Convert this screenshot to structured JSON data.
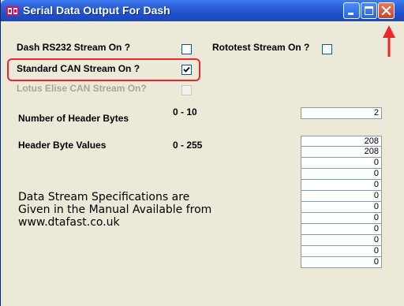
{
  "window": {
    "title": "Serial Data Output For Dash"
  },
  "options": {
    "dash_rs232": {
      "label": "Dash RS232 Stream On ?",
      "checked": false
    },
    "rototest": {
      "label": "Rototest Stream On ?",
      "checked": false
    },
    "standard_can": {
      "label": "Standard CAN Stream On ?",
      "checked": true
    },
    "lotus_elise": {
      "label": "Lotus Elise CAN Stream On?",
      "checked": false,
      "disabled": true
    }
  },
  "header_bytes": {
    "label": "Number of Header Bytes",
    "range": "0 - 10",
    "value": "2"
  },
  "header_values": {
    "label": "Header Byte Values",
    "range": "0 - 255",
    "values": [
      "208",
      "208",
      "0",
      "0",
      "0",
      "0",
      "0",
      "0",
      "0",
      "0",
      "0",
      "0"
    ]
  },
  "spec_text": {
    "line1": "Data Stream Specifications are",
    "line2": "Given in the Manual Available from",
    "line3": "www.dtafast.co.uk"
  },
  "colors": {
    "highlight": "#e8282a",
    "titlebar": "#2a5fd8"
  }
}
